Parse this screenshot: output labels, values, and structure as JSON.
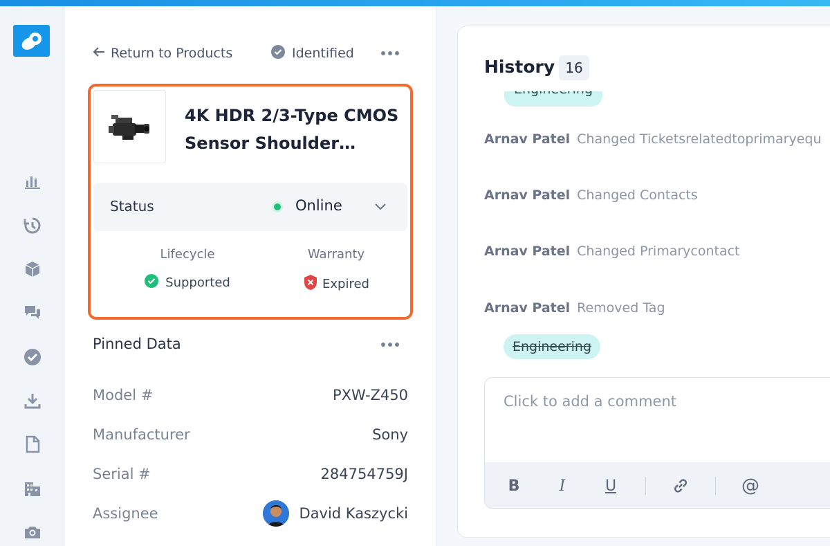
{
  "nav": {
    "back_label": "Return to Products",
    "identified_label": "Identified"
  },
  "product": {
    "title": "4K HDR 2/3-Type CMOS Sensor Shoulder…",
    "status_label": "Status",
    "status_value": "Online",
    "lifecycle_label": "Lifecycle",
    "lifecycle_value": "Supported",
    "warranty_label": "Warranty",
    "warranty_value": "Expired"
  },
  "pinned": {
    "title": "Pinned Data",
    "rows": [
      {
        "key": "Model #",
        "value": "PXW-Z450"
      },
      {
        "key": "Manufacturer",
        "value": "Sony"
      },
      {
        "key": "Serial #",
        "value": "284754759J"
      },
      {
        "key": "Assignee",
        "value": "David Kaszycki"
      }
    ]
  },
  "history": {
    "title": "History",
    "count": "16",
    "partial_tag": "Engineering",
    "entries": [
      {
        "who": "Arnav Patel",
        "what": "Changed Ticketsrelatedtoprimaryequ"
      },
      {
        "who": "Arnav Patel",
        "what": "Changed Contacts"
      },
      {
        "who": "Arnav Patel",
        "what": "Changed Primarycontact"
      },
      {
        "who": "Arnav Patel",
        "what": "Removed Tag"
      }
    ],
    "removed_tag": "Engineering"
  },
  "comment": {
    "placeholder": "Click to add a comment",
    "toolbar": {
      "bold": "B",
      "italic": "I",
      "underline": "U",
      "mention": "@"
    }
  },
  "colors": {
    "accent": "#1596e8",
    "highlight_border": "#f06b2d",
    "online": "#1fbf7a",
    "tag_bg": "#cdf3f3"
  },
  "icons": {
    "rail": [
      "chart-icon",
      "history-icon",
      "cube-icon",
      "chat-icon",
      "check-circle-icon",
      "download-icon",
      "document-icon",
      "building-icon",
      "camera-icon"
    ]
  }
}
